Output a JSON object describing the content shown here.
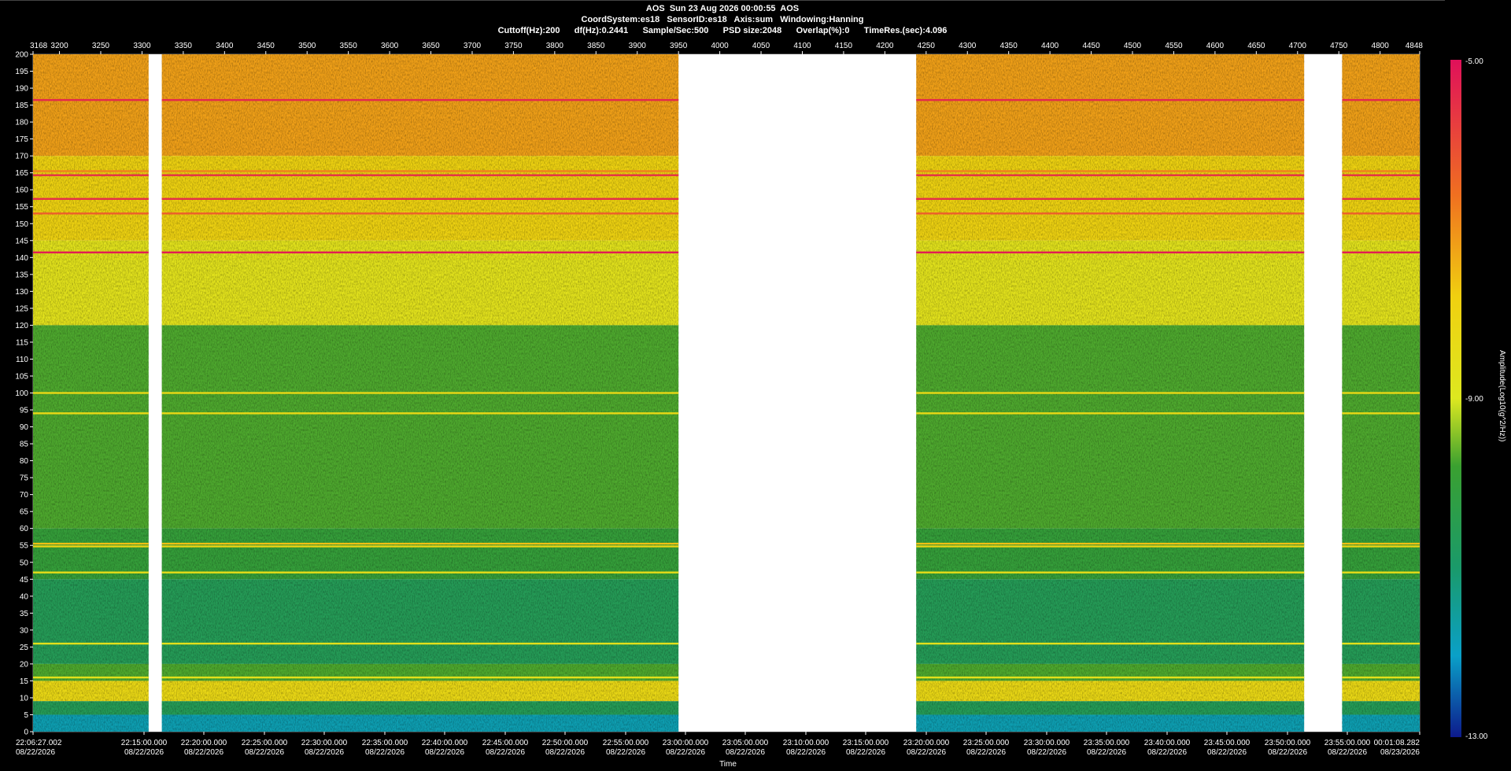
{
  "header": {
    "line1": "AOS  Sun 23 Aug 2026 00:00:55  AOS",
    "line2": "CoordSystem:es18   SensorID:es18   Axis:sum   Windowing:Hanning",
    "line3": "Cuttoff(Hz):200      df(Hz):0.2441      Sample/Sec:500      PSD size:2048      Overlap(%):0      TimeRes.(sec):4.096"
  },
  "chart_data": {
    "type": "heatmap",
    "title": "AOS  Sun 23 Aug 2026 00:00:55  AOS",
    "xlabel": "Time",
    "ylabel": "",
    "colorbar_label": "Amplitude(Log10(g^2/Hz))",
    "colorbar_ticks": [
      "-5.00",
      "-9.00",
      "-13.00"
    ],
    "color_range": [
      -13.0,
      -5.0
    ],
    "ylim": [
      0,
      200
    ],
    "y_ticks": [
      200,
      195,
      190,
      185,
      180,
      175,
      170,
      165,
      160,
      155,
      150,
      145,
      140,
      135,
      130,
      125,
      120,
      115,
      110,
      105,
      100,
      95,
      90,
      85,
      80,
      75,
      70,
      65,
      60,
      55,
      50,
      45,
      40,
      35,
      30,
      25,
      20,
      15,
      10,
      5,
      0
    ],
    "index_range": [
      3168,
      4848
    ],
    "top_ticks": [
      3168,
      3200,
      3250,
      3300,
      3350,
      3400,
      3450,
      3500,
      3550,
      3600,
      3650,
      3700,
      3750,
      3800,
      3850,
      3900,
      3950,
      4000,
      4050,
      4100,
      4150,
      4200,
      4250,
      4300,
      4350,
      4400,
      4450,
      4500,
      4550,
      4600,
      4650,
      4700,
      4750,
      4800,
      4848
    ],
    "time_ticks": [
      {
        "time": "22:06:27.002",
        "date": "08/22/2026"
      },
      {
        "time": "22:15:00.000",
        "date": "08/22/2026"
      },
      {
        "time": "22:20:00.000",
        "date": "08/22/2026"
      },
      {
        "time": "22:25:00.000",
        "date": "08/22/2026"
      },
      {
        "time": "22:30:00.000",
        "date": "08/22/2026"
      },
      {
        "time": "22:35:00.000",
        "date": "08/22/2026"
      },
      {
        "time": "22:40:00.000",
        "date": "08/22/2026"
      },
      {
        "time": "22:45:00.000",
        "date": "08/22/2026"
      },
      {
        "time": "22:50:00.000",
        "date": "08/22/2026"
      },
      {
        "time": "22:55:00.000",
        "date": "08/22/2026"
      },
      {
        "time": "23:00:00.000",
        "date": "08/22/2026"
      },
      {
        "time": "23:05:00.000",
        "date": "08/22/2026"
      },
      {
        "time": "23:10:00.000",
        "date": "08/22/2026"
      },
      {
        "time": "23:15:00.000",
        "date": "08/22/2026"
      },
      {
        "time": "23:20:00.000",
        "date": "08/22/2026"
      },
      {
        "time": "23:25:00.000",
        "date": "08/22/2026"
      },
      {
        "time": "23:30:00.000",
        "date": "08/22/2026"
      },
      {
        "time": "23:35:00.000",
        "date": "08/22/2026"
      },
      {
        "time": "23:40:00.000",
        "date": "08/22/2026"
      },
      {
        "time": "23:45:00.000",
        "date": "08/22/2026"
      },
      {
        "time": "23:50:00.000",
        "date": "08/22/2026"
      },
      {
        "time": "23:55:00.000",
        "date": "08/22/2026"
      },
      {
        "time": "00:01:08.282",
        "date": "08/23/2026"
      }
    ],
    "data_gaps_index": [
      [
        3308,
        3324
      ],
      [
        3950,
        4238
      ],
      [
        4708,
        4754
      ]
    ],
    "frequency_bands": [
      {
        "from": 170,
        "to": 200,
        "level": -7.2
      },
      {
        "from": 145,
        "to": 170,
        "level": -7.9
      },
      {
        "from": 120,
        "to": 145,
        "level": -8.7
      },
      {
        "from": 60,
        "to": 120,
        "level": -9.7
      },
      {
        "from": 45,
        "to": 60,
        "level": -10.0
      },
      {
        "from": 20,
        "to": 45,
        "level": -10.6
      },
      {
        "from": 15,
        "to": 20,
        "level": -9.7
      },
      {
        "from": 9,
        "to": 15,
        "level": -8.2
      },
      {
        "from": 5,
        "to": 9,
        "level": -10.6
      },
      {
        "from": 0,
        "to": 5,
        "level": -11.8
      }
    ],
    "tonal_lines": [
      {
        "freq": 186.5,
        "level": -5.4
      },
      {
        "freq": 165.5,
        "level": -6.8
      },
      {
        "freq": 164.3,
        "level": -5.5
      },
      {
        "freq": 157.3,
        "level": -5.5
      },
      {
        "freq": 153.0,
        "level": -6.3
      },
      {
        "freq": 141.5,
        "level": -5.2
      },
      {
        "freq": 100.0,
        "level": -8.2
      },
      {
        "freq": 94.0,
        "level": -8.2
      },
      {
        "freq": 55.5,
        "level": -7.6
      },
      {
        "freq": 54.7,
        "level": -8.0
      },
      {
        "freq": 47.0,
        "level": -8.4
      },
      {
        "freq": 26.0,
        "level": -8.6
      },
      {
        "freq": 16.0,
        "level": -8.6
      }
    ]
  }
}
